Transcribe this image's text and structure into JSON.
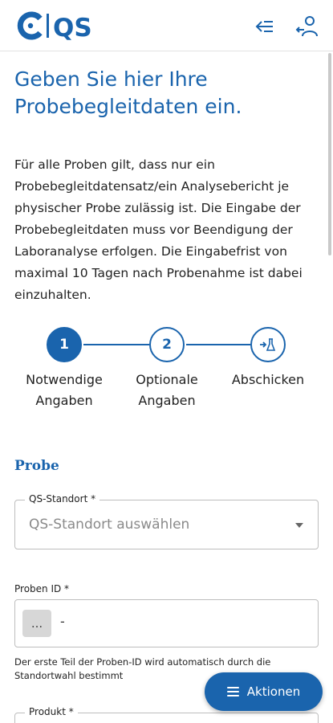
{
  "header": {
    "logo_text": "QS",
    "collapse_icon": "collapse-left-icon",
    "user_icon": "user-logout-icon",
    "brand_color": "#1a64ad"
  },
  "main": {
    "title": "Geben Sie hier Ihre Probebegleitdaten ein.",
    "intro": "Für alle Proben gilt, dass nur ein Probebegleitdatensatz/ein Analysebericht je physischer Probe zulässig ist. Die Eingabe der Probebegleitdaten muss vor Beendigung der Laboranalyse erfolgen. Die Eingabefrist von maximal 10 Tagen nach Probenahme ist dabei einzuhalten."
  },
  "stepper": {
    "steps": [
      {
        "number": "1",
        "label": "Notwendige Angaben",
        "active": true
      },
      {
        "number": "2",
        "label": "Optionale Angaben",
        "active": false
      },
      {
        "icon": "send-flask-icon",
        "label": "Abschicken",
        "active": false
      }
    ]
  },
  "form": {
    "section_title": "Probe",
    "standort": {
      "label": "QS-Standort *",
      "placeholder": "QS-Standort auswählen"
    },
    "proben_id": {
      "label": "Proben ID *",
      "prefix": "...",
      "separator": "-",
      "help": "Der erste Teil der Proben-ID wird automatisch durch die Standortwahl bestimmt"
    },
    "produkt": {
      "label": "Produkt *"
    }
  },
  "actions": {
    "label": "Aktionen"
  }
}
